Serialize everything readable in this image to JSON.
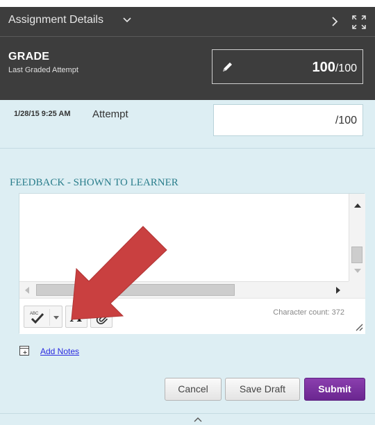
{
  "header": {
    "title": "Assignment Details",
    "chevron_icon": "chevron-down-icon",
    "next_icon": "chevron-right-icon",
    "expand_icon": "expand-icon"
  },
  "grade": {
    "label": "GRADE",
    "sublabel": "Last Graded Attempt",
    "score": "100",
    "max": "/100",
    "edit_icon": "pencil-icon"
  },
  "attempt": {
    "date": "1/28/15 9:25 AM",
    "label": "Attempt",
    "max": "/100"
  },
  "feedback": {
    "title": "FEEDBACK - SHOWN TO LEARNER",
    "character_count": "Character count: 372",
    "toolbar": {
      "spellcheck_icon": "spellcheck-icon",
      "font_icon_glyph": "A",
      "attach_icon": "paperclip-icon"
    }
  },
  "notes": {
    "label": "Add Notes",
    "icon": "notes-icon"
  },
  "actions": {
    "cancel": "Cancel",
    "save_draft": "Save Draft",
    "submit": "Submit"
  },
  "colors": {
    "header_bg": "#3d3d3d",
    "panel_bg": "#ddeef3",
    "feedback_title": "#2a7e8c",
    "submit_bg": "#7a2fa0",
    "annotation_arrow": "#c83a3a",
    "link": "#2a2ae0"
  }
}
